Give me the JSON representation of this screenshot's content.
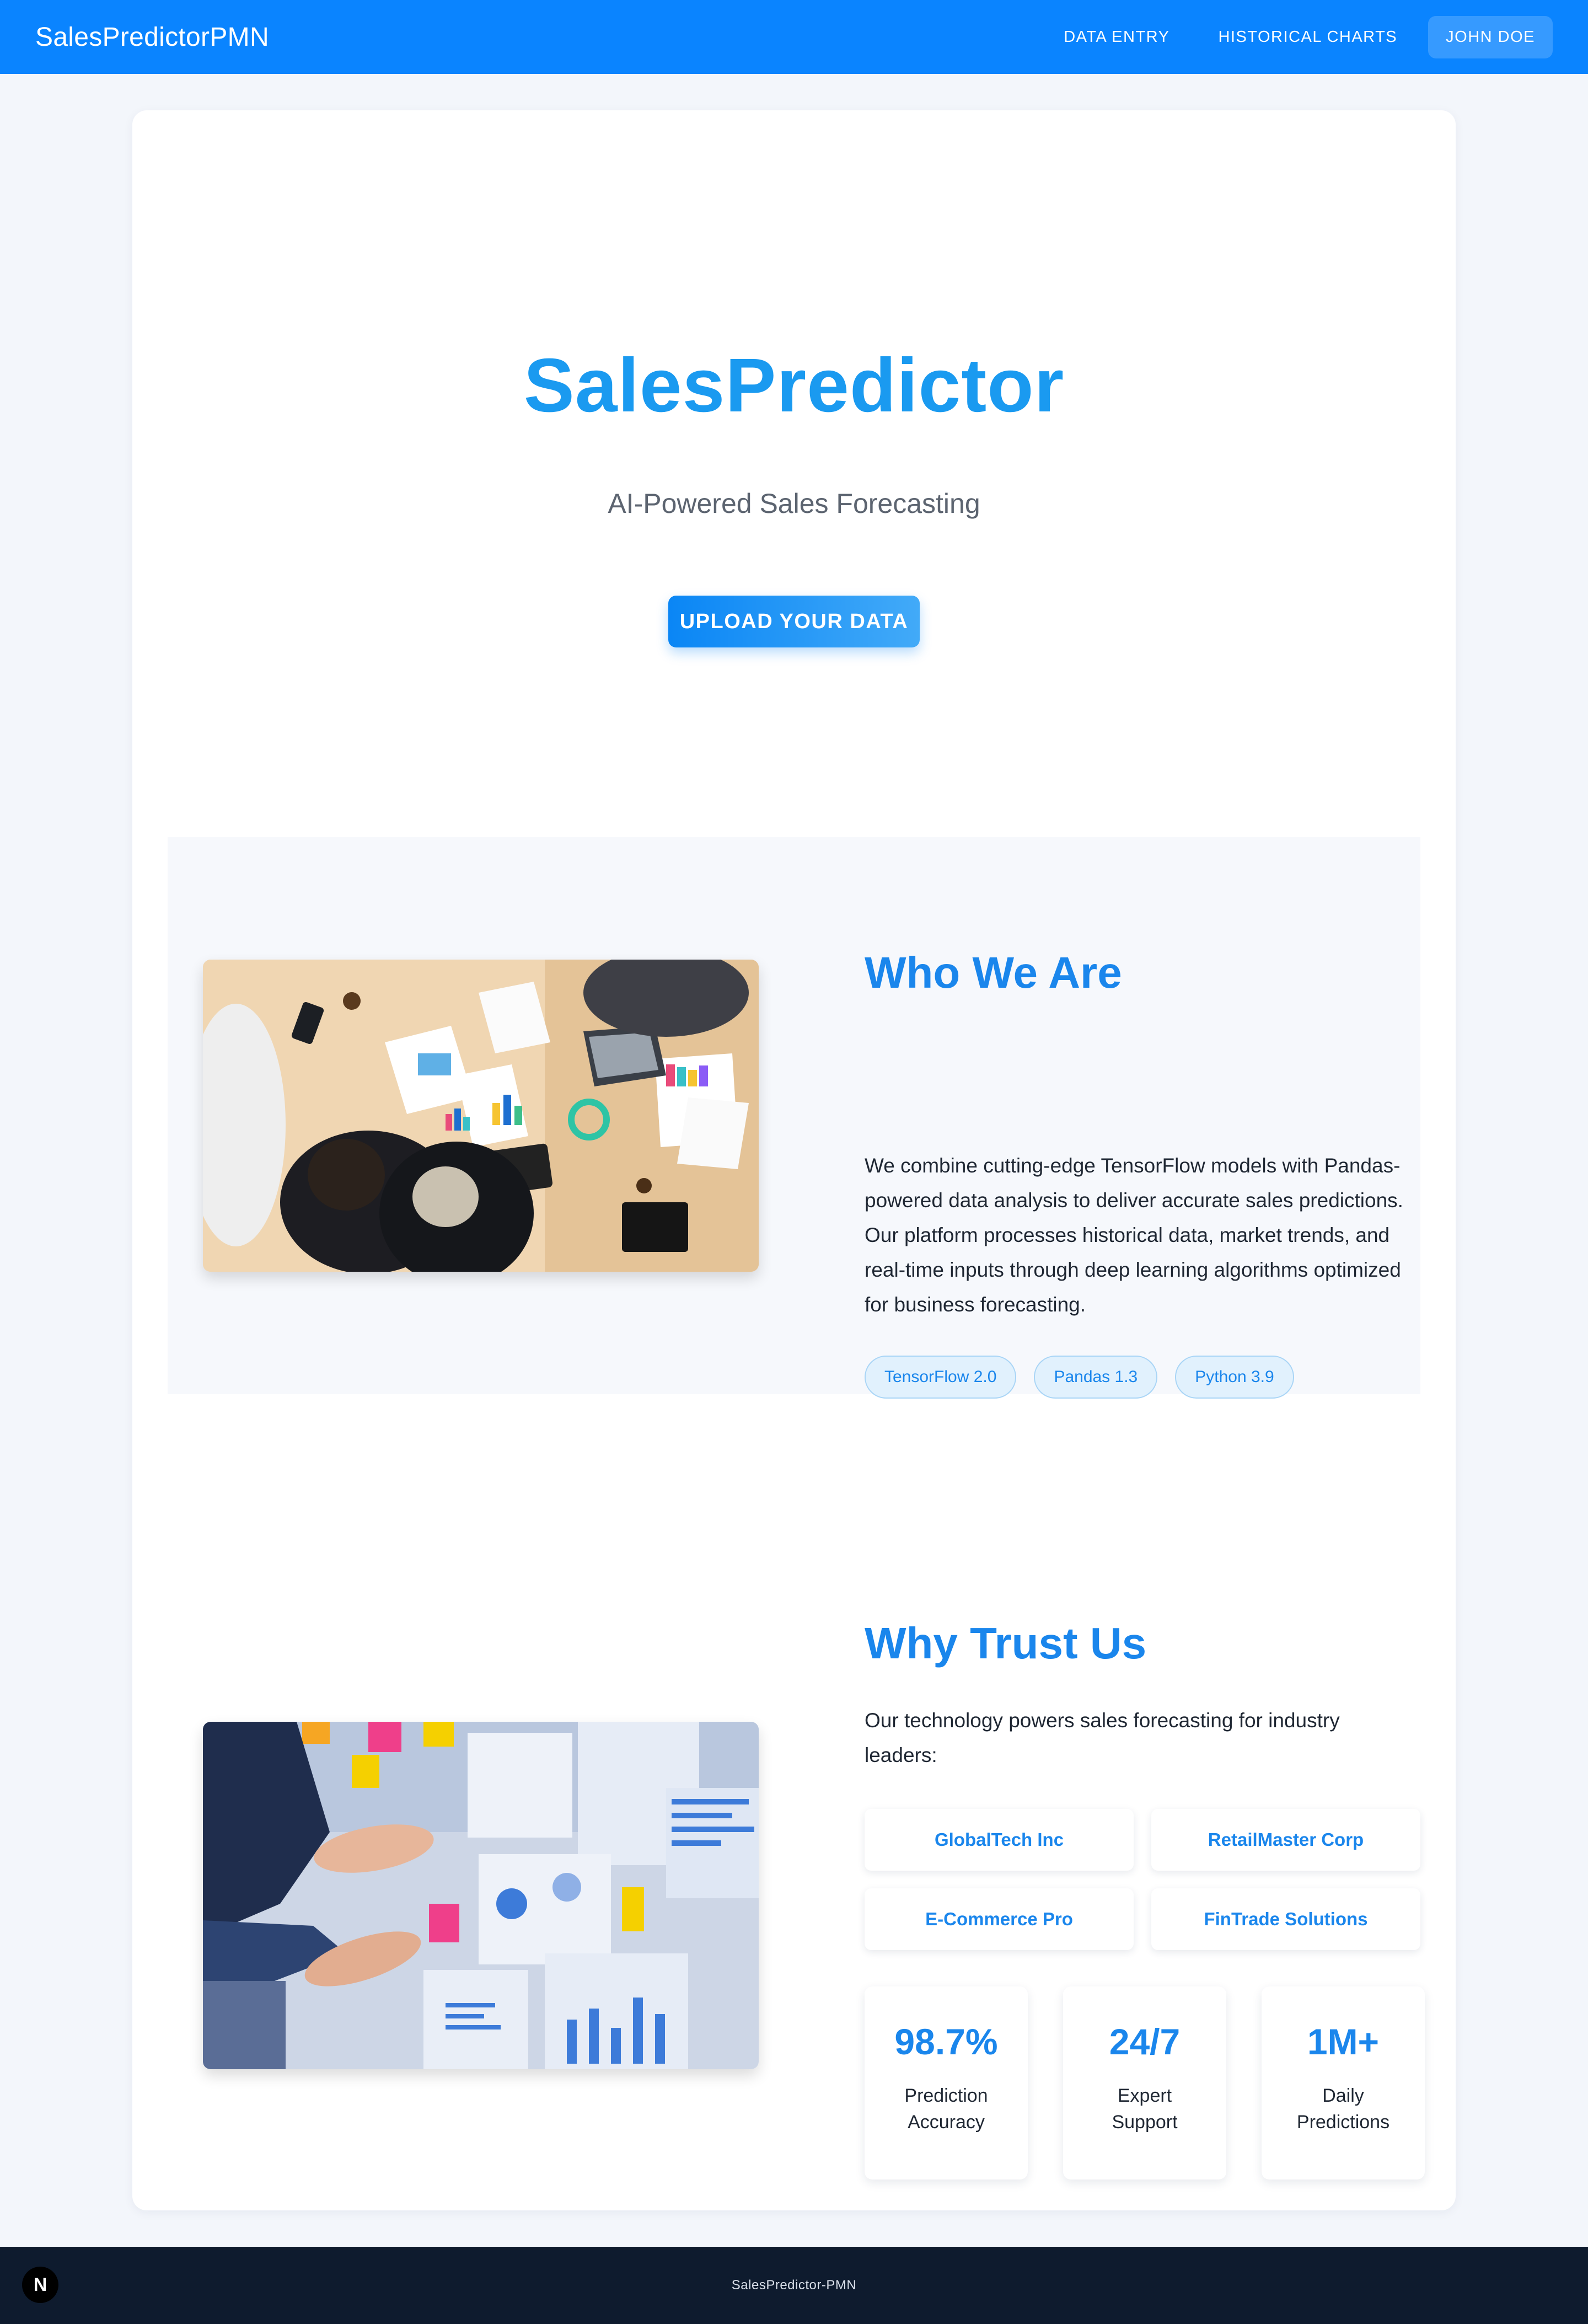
{
  "navbar": {
    "brand": "SalesPredictorPMN",
    "links": [
      "DATA ENTRY",
      "HISTORICAL CHARTS"
    ],
    "user": "JOHN DOE"
  },
  "hero": {
    "title": "SalesPredictor",
    "subtitle": "AI-Powered Sales Forecasting",
    "button": "UPLOAD YOUR DATA"
  },
  "who": {
    "title": "Who We Are",
    "text": "We combine cutting-edge TensorFlow models with Pandas-powered data analysis to deliver accurate sales predictions. Our platform processes historical data, market trends, and real-time inputs through deep learning algorithms optimized for business forecasting.",
    "tags": [
      "TensorFlow 2.0",
      "Pandas 1.3",
      "Python 3.9"
    ]
  },
  "trust": {
    "title": "Why Trust Us",
    "text": "Our technology powers sales forecasting for industry leaders:",
    "clients": [
      "GlobalTech Inc",
      "RetailMaster Corp",
      "E-Commerce Pro",
      "FinTrade Solutions"
    ],
    "stats": [
      {
        "value": "98.7%",
        "label": "Prediction Accuracy"
      },
      {
        "value": "24/7",
        "label": "Expert Support"
      },
      {
        "value": "1M+",
        "label": "Daily Predictions"
      }
    ]
  },
  "footer": {
    "text": "SalesPredictor-PMN",
    "badge": "N"
  },
  "colors": {
    "primary": "#0a84ff",
    "accent_text": "#1a86ec",
    "footer_bg": "#0e1b2e"
  }
}
